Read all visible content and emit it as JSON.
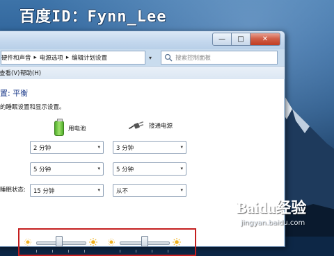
{
  "watermark": {
    "baidu_id": "百度ID：Fynn_Lee",
    "baidu_logo": "Baidu经验",
    "baidu_url": "jingyan.baidu.com"
  },
  "window": {
    "caption": {
      "minimize": "—",
      "maximize": "□",
      "close": "✕"
    },
    "address": {
      "crumbs": [
        "硬件和声音",
        "电源选项",
        "编辑计划设置"
      ],
      "separator": "▸",
      "dropdown": "▾",
      "refresh": "↻"
    },
    "search": {
      "placeholder": "搜索控制面板"
    },
    "menu": {
      "view": "查看(V)",
      "help": "帮助(H)"
    }
  },
  "content": {
    "heading": "置: 平衡",
    "description": "的睡眠设置和显示设置。",
    "columns": {
      "battery": "用电池",
      "plugged_in": "接通电源"
    },
    "rows": [
      {
        "label": "",
        "battery_value": "2 分钟",
        "plugged_value": "3 分钟"
      },
      {
        "label": "",
        "battery_value": "5 分钟",
        "plugged_value": "5 分钟"
      },
      {
        "label": "睡眠状态:",
        "battery_value": "15 分钟",
        "plugged_value": "从不"
      }
    ],
    "brightness": {
      "battery_level": 0.45,
      "plugged_level": 0.5
    },
    "dropdown_arrow": "▾"
  },
  "icons": {
    "battery": "battery-icon",
    "plug": "power-plug-icon",
    "sun_dim": "dim-sun-icon",
    "sun_bright": "bright-sun-icon",
    "search": "search-icon"
  }
}
